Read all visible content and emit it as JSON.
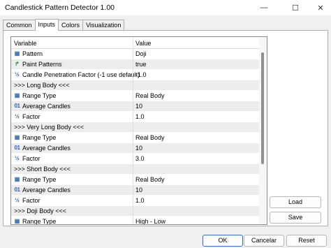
{
  "window": {
    "title": "Candlestick Pattern Detector 1.00",
    "minimize_glyph": "—",
    "maximize_glyph": "☐",
    "close_glyph": "✕"
  },
  "tabs": [
    {
      "label": "Common",
      "active": false
    },
    {
      "label": "Inputs",
      "active": true
    },
    {
      "label": "Colors",
      "active": false
    },
    {
      "label": "Visualization",
      "active": false
    }
  ],
  "grid": {
    "col_variable": "Variable",
    "col_value": "Value",
    "rows": [
      {
        "icon": "grid-icon",
        "name": "Pattern",
        "value": "Doji"
      },
      {
        "icon": "arrow-icon",
        "name": "Paint Patterns",
        "value": "true"
      },
      {
        "icon": "fraction-icon",
        "name": "Candle Penetration Factor (-1 use default)",
        "value": "-1.0"
      },
      {
        "icon": "",
        "name": ">>> Long Body <<<",
        "value": ""
      },
      {
        "icon": "grid-icon",
        "name": "Range Type",
        "value": "Real Body"
      },
      {
        "icon": "integer-icon",
        "name": "Average Candles",
        "value": "10"
      },
      {
        "icon": "fraction-icon",
        "name": "Factor",
        "value": "1.0"
      },
      {
        "icon": "",
        "name": ">>> Very Long Body <<<",
        "value": ""
      },
      {
        "icon": "grid-icon",
        "name": "Range Type",
        "value": "Real Body"
      },
      {
        "icon": "integer-icon",
        "name": "Average Candles",
        "value": "10"
      },
      {
        "icon": "fraction-icon",
        "name": "Factor",
        "value": "3.0"
      },
      {
        "icon": "",
        "name": ">>> Short Body <<<",
        "value": ""
      },
      {
        "icon": "grid-icon",
        "name": "Range Type",
        "value": "Real Body"
      },
      {
        "icon": "integer-icon",
        "name": "Average Candles",
        "value": "10"
      },
      {
        "icon": "fraction-icon",
        "name": "Factor",
        "value": "1.0"
      },
      {
        "icon": "",
        "name": ">>> Doji Body <<<",
        "value": ""
      },
      {
        "icon": "grid-icon",
        "name": "Range Type",
        "value": "High - Low"
      }
    ]
  },
  "icons": {
    "grid-icon": "▦",
    "arrow-icon": "↱",
    "fraction-icon": "½",
    "integer-icon": "01"
  },
  "buttons": {
    "load": "Load",
    "save": "Save",
    "ok": "OK",
    "cancel": "Cancelar",
    "reset": "Reset"
  }
}
